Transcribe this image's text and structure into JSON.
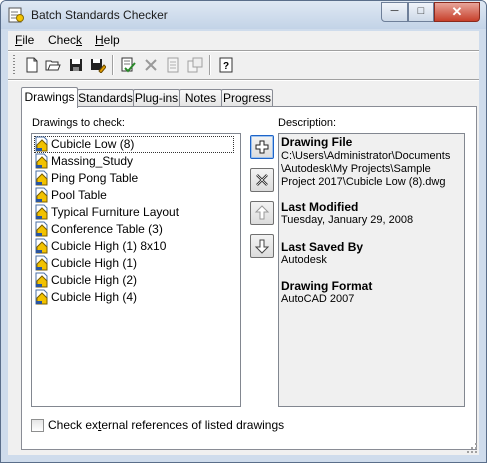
{
  "window": {
    "title": "Batch Standards Checker"
  },
  "menubar": {
    "items": [
      {
        "label": "File",
        "access": "F",
        "rest": "ile"
      },
      {
        "label": "Check",
        "access": "",
        "rest": "Chec",
        "tail": "k",
        "tail_underline": true
      },
      {
        "label": "Help",
        "access": "H",
        "rest": "elp"
      }
    ]
  },
  "toolbar": {
    "icons": [
      "new-icon",
      "open-icon",
      "save-icon",
      "save-as-icon",
      "check-standards-icon",
      "stop-icon",
      "view-report-icon",
      "export-report-icon",
      "help-icon"
    ]
  },
  "tabs": [
    "Drawings",
    "Standards",
    "Plug-ins",
    "Notes",
    "Progress"
  ],
  "active_tab": "Drawings",
  "drawings": {
    "label": "Drawings to check:",
    "items": [
      "Cubicle Low (8)",
      "Massing_Study",
      "Ping Pong Table",
      "Pool Table",
      "Typical Furniture Layout",
      "Conference Table (3)",
      "Cubicle High (1) 8x10",
      "Cubicle High (1)",
      "Cubicle High (2)",
      "Cubicle High (4)"
    ]
  },
  "side_buttons": [
    "add-drawing-icon",
    "remove-drawing-icon",
    "move-up-icon",
    "move-down-icon"
  ],
  "description": {
    "label": "Description:",
    "drawing_file_heading": "Drawing File",
    "drawing_file_value": "C:\\Users\\Administrator\\Documents\n\\Autodesk\\My Projects\\Sample\nProject 2017\\Cubicle Low (8).dwg",
    "last_modified_heading": "Last Modified",
    "last_modified_value": "Tuesday, January 29, 2008",
    "last_saved_heading": "Last Saved By",
    "last_saved_value": "Autodesk",
    "format_heading": "Drawing Format",
    "format_value": "AutoCAD 2007"
  },
  "xref_check": {
    "label_pre": "Check ex",
    "label_access": "t",
    "label_post": "ernal references of listed drawings",
    "checked": false
  },
  "colors": {
    "selection_border": "#1e64c8",
    "close_button": "#c7402b"
  }
}
